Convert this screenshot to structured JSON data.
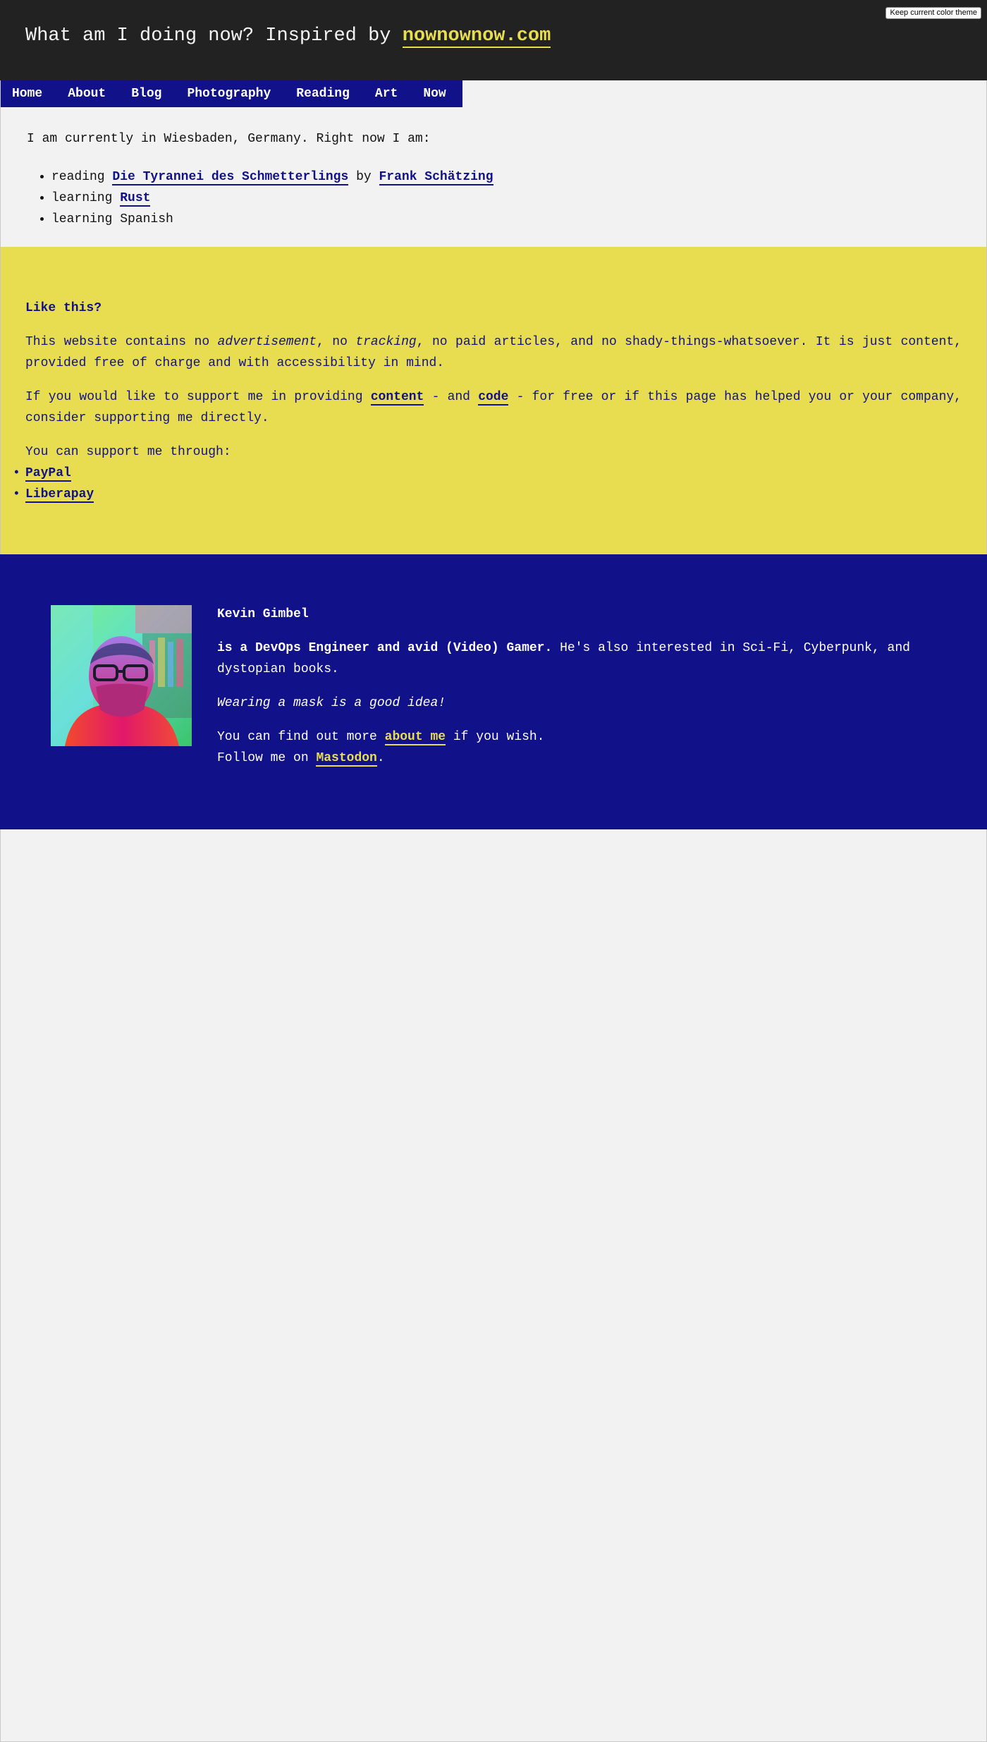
{
  "theme_button": "Keep current color theme",
  "header": {
    "title_prefix": "What am I doing now? Inspired by ",
    "title_link": "nownownow.com"
  },
  "nav": {
    "items": [
      "Home",
      "About",
      "Blog",
      "Photography",
      "Reading",
      "Art",
      "Now"
    ]
  },
  "now": {
    "intro": "I am currently in Wiesbaden, Germany. Right now I am:",
    "items": [
      {
        "prefix": "reading ",
        "link": "Die Tyrannei des Schmetterlings",
        "middle": " by ",
        "link2": "Frank Schätzing"
      },
      {
        "prefix": "learning ",
        "link": "Rust"
      },
      {
        "text": "learning Spanish"
      }
    ]
  },
  "support": {
    "heading": "Like this?",
    "p1_a": "This website contains no ",
    "p1_em1": "advertisement",
    "p1_b": ", no ",
    "p1_em2": "tracking",
    "p1_c": ", no paid articles, and no shady-things-whatsoever. It is just content, provided free of charge and with accessibility in mind.",
    "p2_a": "If you would like to support me in providing ",
    "p2_link1": "content",
    "p2_b": " - and ",
    "p2_link2": "code",
    "p2_c": " - for free or if this page has helped you or your company, consider supporting me directly.",
    "p3": "You can support me through:",
    "options": [
      "PayPal",
      "Liberapay"
    ]
  },
  "author": {
    "name": "Kevin Gimbel",
    "role_bold": "is a DevOps Engineer and avid (Video) Gamer.",
    "role_rest": " He's also interested in Sci-Fi, Cyberpunk, and dystopian books.",
    "mask_note": "Wearing a mask is a good idea!",
    "more_a": "You can find out more ",
    "more_link": "about me",
    "more_b": " if you wish.",
    "follow_a": "Follow me on ",
    "follow_link": "Mastodon",
    "follow_b": "."
  },
  "colors": {
    "header_bg": "#222222",
    "nav_bg": "#11128a",
    "accent_yellow": "#e8dc50",
    "page_bg": "#f2f2f2"
  }
}
